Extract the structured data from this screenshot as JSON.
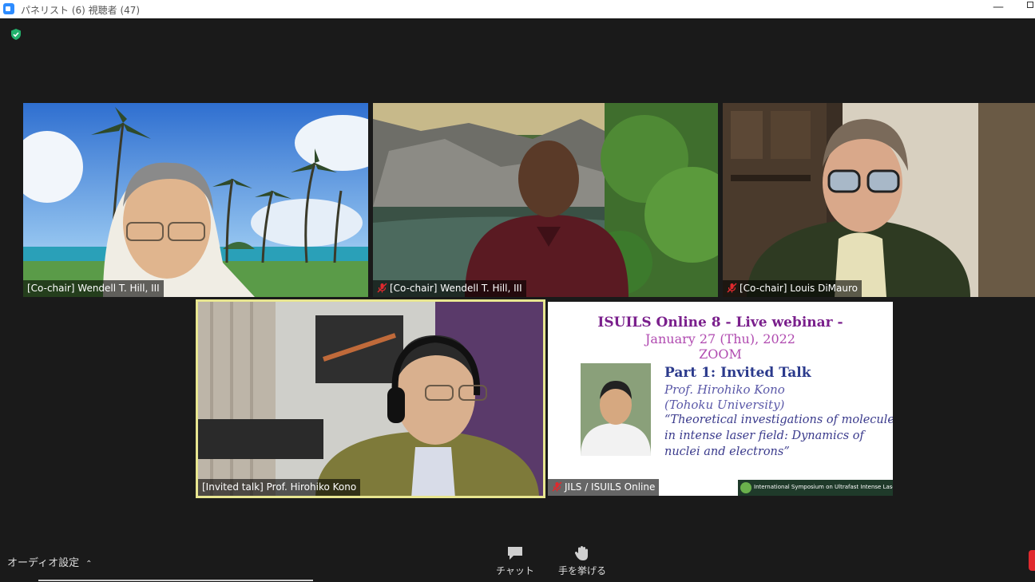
{
  "window": {
    "title": "パネリスト (6) 視聴者 (47)",
    "minimize": "—"
  },
  "tiles": [
    {
      "name": "[Co-chair] Wendell T. Hill, III",
      "muted": false
    },
    {
      "name": "[Co-chair] Wendell T. Hill, III",
      "muted": true
    },
    {
      "name": "[Co-chair] Louis DiMauro",
      "muted": true
    },
    {
      "name": "[Invited talk] Prof. Hirohiko Kono",
      "muted": false,
      "active_speaker": true
    },
    {
      "name": "JILS / ISUILS Online",
      "muted": true
    }
  ],
  "slide": {
    "title": "ISUILS Online 8 - Live webinar -",
    "date": "January 27 (Thu), 2022",
    "platform": "ZOOM",
    "part": "Part 1: Invited Talk",
    "speaker": "Prof. Hirohiko Kono",
    "affiliation": "(Tohoku University)",
    "talk_line1": "“Theoretical investigations of molecules",
    "talk_line2": "in intense laser field: Dynamics of",
    "talk_line3": "nuclei and electrons”",
    "footer": "International Symposium on Ultrafast Intense Laser Science"
  },
  "toolbar": {
    "audio_settings": "オーディオ設定",
    "chat": "チャット",
    "raise_hand": "手を挙げる"
  },
  "colors": {
    "active_border": "#e8e690",
    "slide_title": "#7a1f8c",
    "slide_date": "#b04ab0",
    "slide_part": "#2b3a8c"
  }
}
